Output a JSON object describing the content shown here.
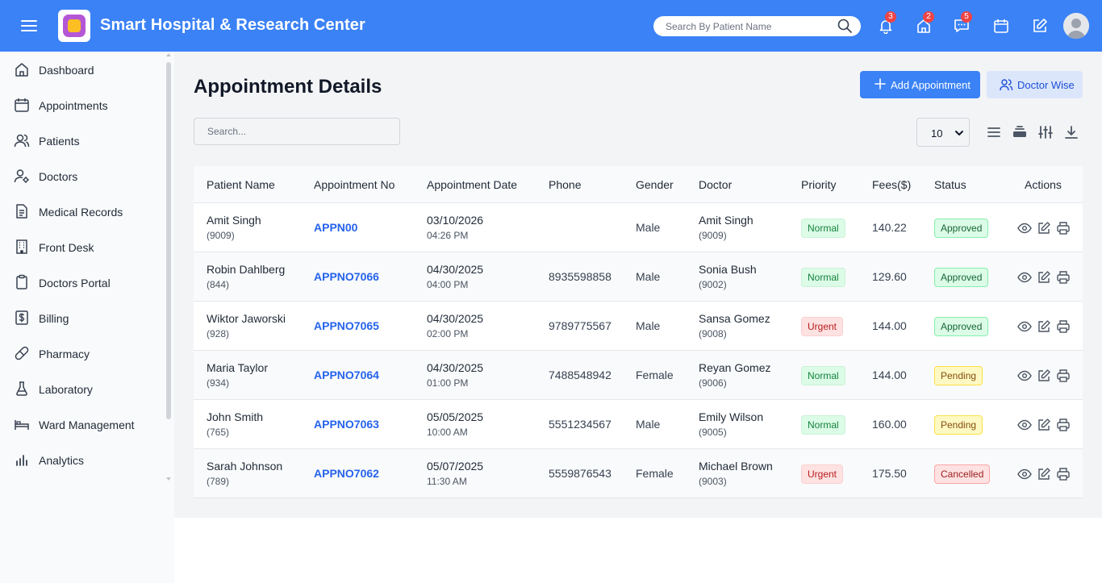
{
  "app": {
    "title": "Smart Hospital & Research Center"
  },
  "header": {
    "search_placeholder": "Search By Patient Name",
    "notifications_count": "3",
    "home_count": "2",
    "messages_count": "5",
    "avatar_alt": "User"
  },
  "sidebar": {
    "items": [
      {
        "label": "Dashboard",
        "icon": "home-icon"
      },
      {
        "label": "Appointments",
        "icon": "calendar-icon"
      },
      {
        "label": "Patients",
        "icon": "users-icon"
      },
      {
        "label": "Doctors",
        "icon": "user-gear-icon"
      },
      {
        "label": "Medical Records",
        "icon": "file-text-icon"
      },
      {
        "label": "Front Desk",
        "icon": "building-icon"
      },
      {
        "label": "Doctors Portal",
        "icon": "clipboard-icon"
      },
      {
        "label": "Billing",
        "icon": "dollar-icon"
      },
      {
        "label": "Pharmacy",
        "icon": "pill-icon"
      },
      {
        "label": "Laboratory",
        "icon": "flask-icon"
      },
      {
        "label": "Ward Management",
        "icon": "bed-icon"
      },
      {
        "label": "Analytics",
        "icon": "bar-chart-icon"
      }
    ]
  },
  "main": {
    "title": "Appointment Details",
    "add_button": "Add Appointment",
    "doctor_wise_button": "Doctor Wise",
    "search_placeholder": "Search...",
    "page_size": "10",
    "columns": [
      "Patient Name",
      "Appointment No",
      "Appointment Date",
      "Phone",
      "Gender",
      "Doctor",
      "Priority",
      "Fees($)",
      "Status",
      "Actions"
    ],
    "rows": [
      {
        "patient": "Amit Singh",
        "patient_id": "(9009)",
        "appt_no": "APPN00",
        "date": "03/10/2026",
        "time": "04:26 PM",
        "phone": "",
        "gender": "Male",
        "doctor": "Amit Singh",
        "doctor_id": "(9009)",
        "priority": "Normal",
        "fees": "140.22",
        "status": "Approved"
      },
      {
        "patient": "Robin Dahlberg",
        "patient_id": "(844)",
        "appt_no": "APPNO7066",
        "date": "04/30/2025",
        "time": "04:00 PM",
        "phone": "8935598858",
        "gender": "Male",
        "doctor": "Sonia Bush",
        "doctor_id": "(9002)",
        "priority": "Normal",
        "fees": "129.60",
        "status": "Approved"
      },
      {
        "patient": "Wiktor Jaworski",
        "patient_id": "(928)",
        "appt_no": "APPNO7065",
        "date": "04/30/2025",
        "time": "02:00 PM",
        "phone": "9789775567",
        "gender": "Male",
        "doctor": "Sansa Gomez",
        "doctor_id": "(9008)",
        "priority": "Urgent",
        "fees": "144.00",
        "status": "Approved"
      },
      {
        "patient": "Maria Taylor",
        "patient_id": "(934)",
        "appt_no": "APPNO7064",
        "date": "04/30/2025",
        "time": "01:00 PM",
        "phone": "7488548942",
        "gender": "Female",
        "doctor": "Reyan Gomez",
        "doctor_id": "(9006)",
        "priority": "Normal",
        "fees": "144.00",
        "status": "Pending"
      },
      {
        "patient": "John Smith",
        "patient_id": "(765)",
        "appt_no": "APPNO7063",
        "date": "05/05/2025",
        "time": "10:00 AM",
        "phone": "5551234567",
        "gender": "Male",
        "doctor": "Emily Wilson",
        "doctor_id": "(9005)",
        "priority": "Normal",
        "fees": "160.00",
        "status": "Pending"
      },
      {
        "patient": "Sarah Johnson",
        "patient_id": "(789)",
        "appt_no": "APPNO7062",
        "date": "05/07/2025",
        "time": "11:30 AM",
        "phone": "5559876543",
        "gender": "Female",
        "doctor": "Michael Brown",
        "doctor_id": "(9003)",
        "priority": "Urgent",
        "fees": "175.50",
        "status": "Cancelled"
      }
    ]
  },
  "colors": {
    "primary": "#3b82f6",
    "link": "#2563eb",
    "normal_bg": "#dcfce7",
    "urgent_bg": "#fee2e2",
    "pending_bg": "#fef9c3"
  }
}
